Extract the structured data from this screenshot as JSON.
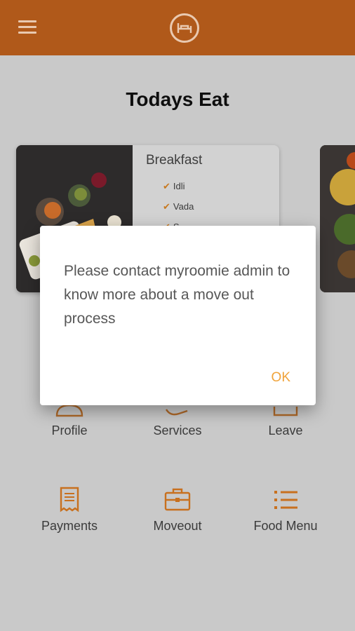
{
  "header": {
    "menu_icon": "hamburger-icon",
    "logo_icon": "bed-logo-icon",
    "color": "#b0591a"
  },
  "page": {
    "title": "Todays Eat"
  },
  "meal_cards": [
    {
      "title": "Breakfast",
      "items": [
        "Idli",
        "Vada",
        "S..."
      ]
    }
  ],
  "tiles": [
    {
      "label": "Profile",
      "icon": "profile-icon"
    },
    {
      "label": "Services",
      "icon": "services-icon"
    },
    {
      "label": "Leave",
      "icon": "leave-icon"
    },
    {
      "label": "Payments",
      "icon": "receipt-icon"
    },
    {
      "label": "Moveout",
      "icon": "briefcase-icon"
    },
    {
      "label": "Food Menu",
      "icon": "list-icon"
    }
  ],
  "dialog": {
    "message": "Please contact myroomie admin to know more about a move out process",
    "ok_label": "OK"
  },
  "colors": {
    "accent": "#c8701e",
    "dialog_ok": "#f0a33a",
    "overlay": "#c9c9c9"
  }
}
